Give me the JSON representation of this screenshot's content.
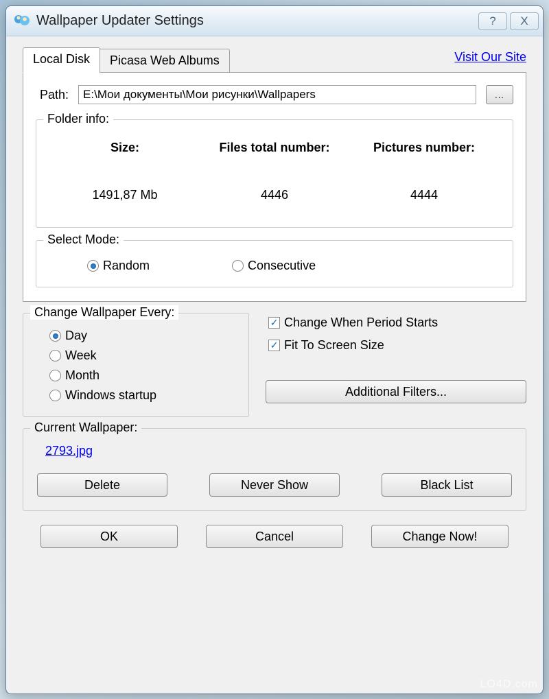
{
  "window": {
    "title": "Wallpaper Updater Settings"
  },
  "titlebar": {
    "help": "?",
    "close": "X"
  },
  "link": {
    "visit": "Visit Our Site"
  },
  "tabs": {
    "local": "Local Disk",
    "picasa": "Picasa Web Albums"
  },
  "path": {
    "label": "Path:",
    "value": "E:\\Мои документы\\Мои рисунки\\Wallpapers",
    "browse": "..."
  },
  "folder_info": {
    "legend": "Folder info:",
    "headers": {
      "size": "Size:",
      "files": "Files total number:",
      "pics": "Pictures number:"
    },
    "values": {
      "size": "1491,87 Mb",
      "files": "4446",
      "pics": "4444"
    }
  },
  "mode": {
    "legend": "Select Mode:",
    "random": "Random",
    "consecutive": "Consecutive"
  },
  "frequency": {
    "legend": "Change Wallpaper Every:",
    "day": "Day",
    "week": "Week",
    "month": "Month",
    "startup": "Windows startup"
  },
  "options": {
    "period": "Change When Period Starts",
    "fit": "Fit To Screen Size",
    "filters": "Additional Filters..."
  },
  "current": {
    "legend": "Current Wallpaper:",
    "file": "2793.jpg",
    "delete": "Delete",
    "never": "Never Show",
    "blacklist": "Black List"
  },
  "bottom": {
    "ok": "OK",
    "cancel": "Cancel",
    "change": "Change Now!"
  },
  "watermark": "LO4D.com"
}
